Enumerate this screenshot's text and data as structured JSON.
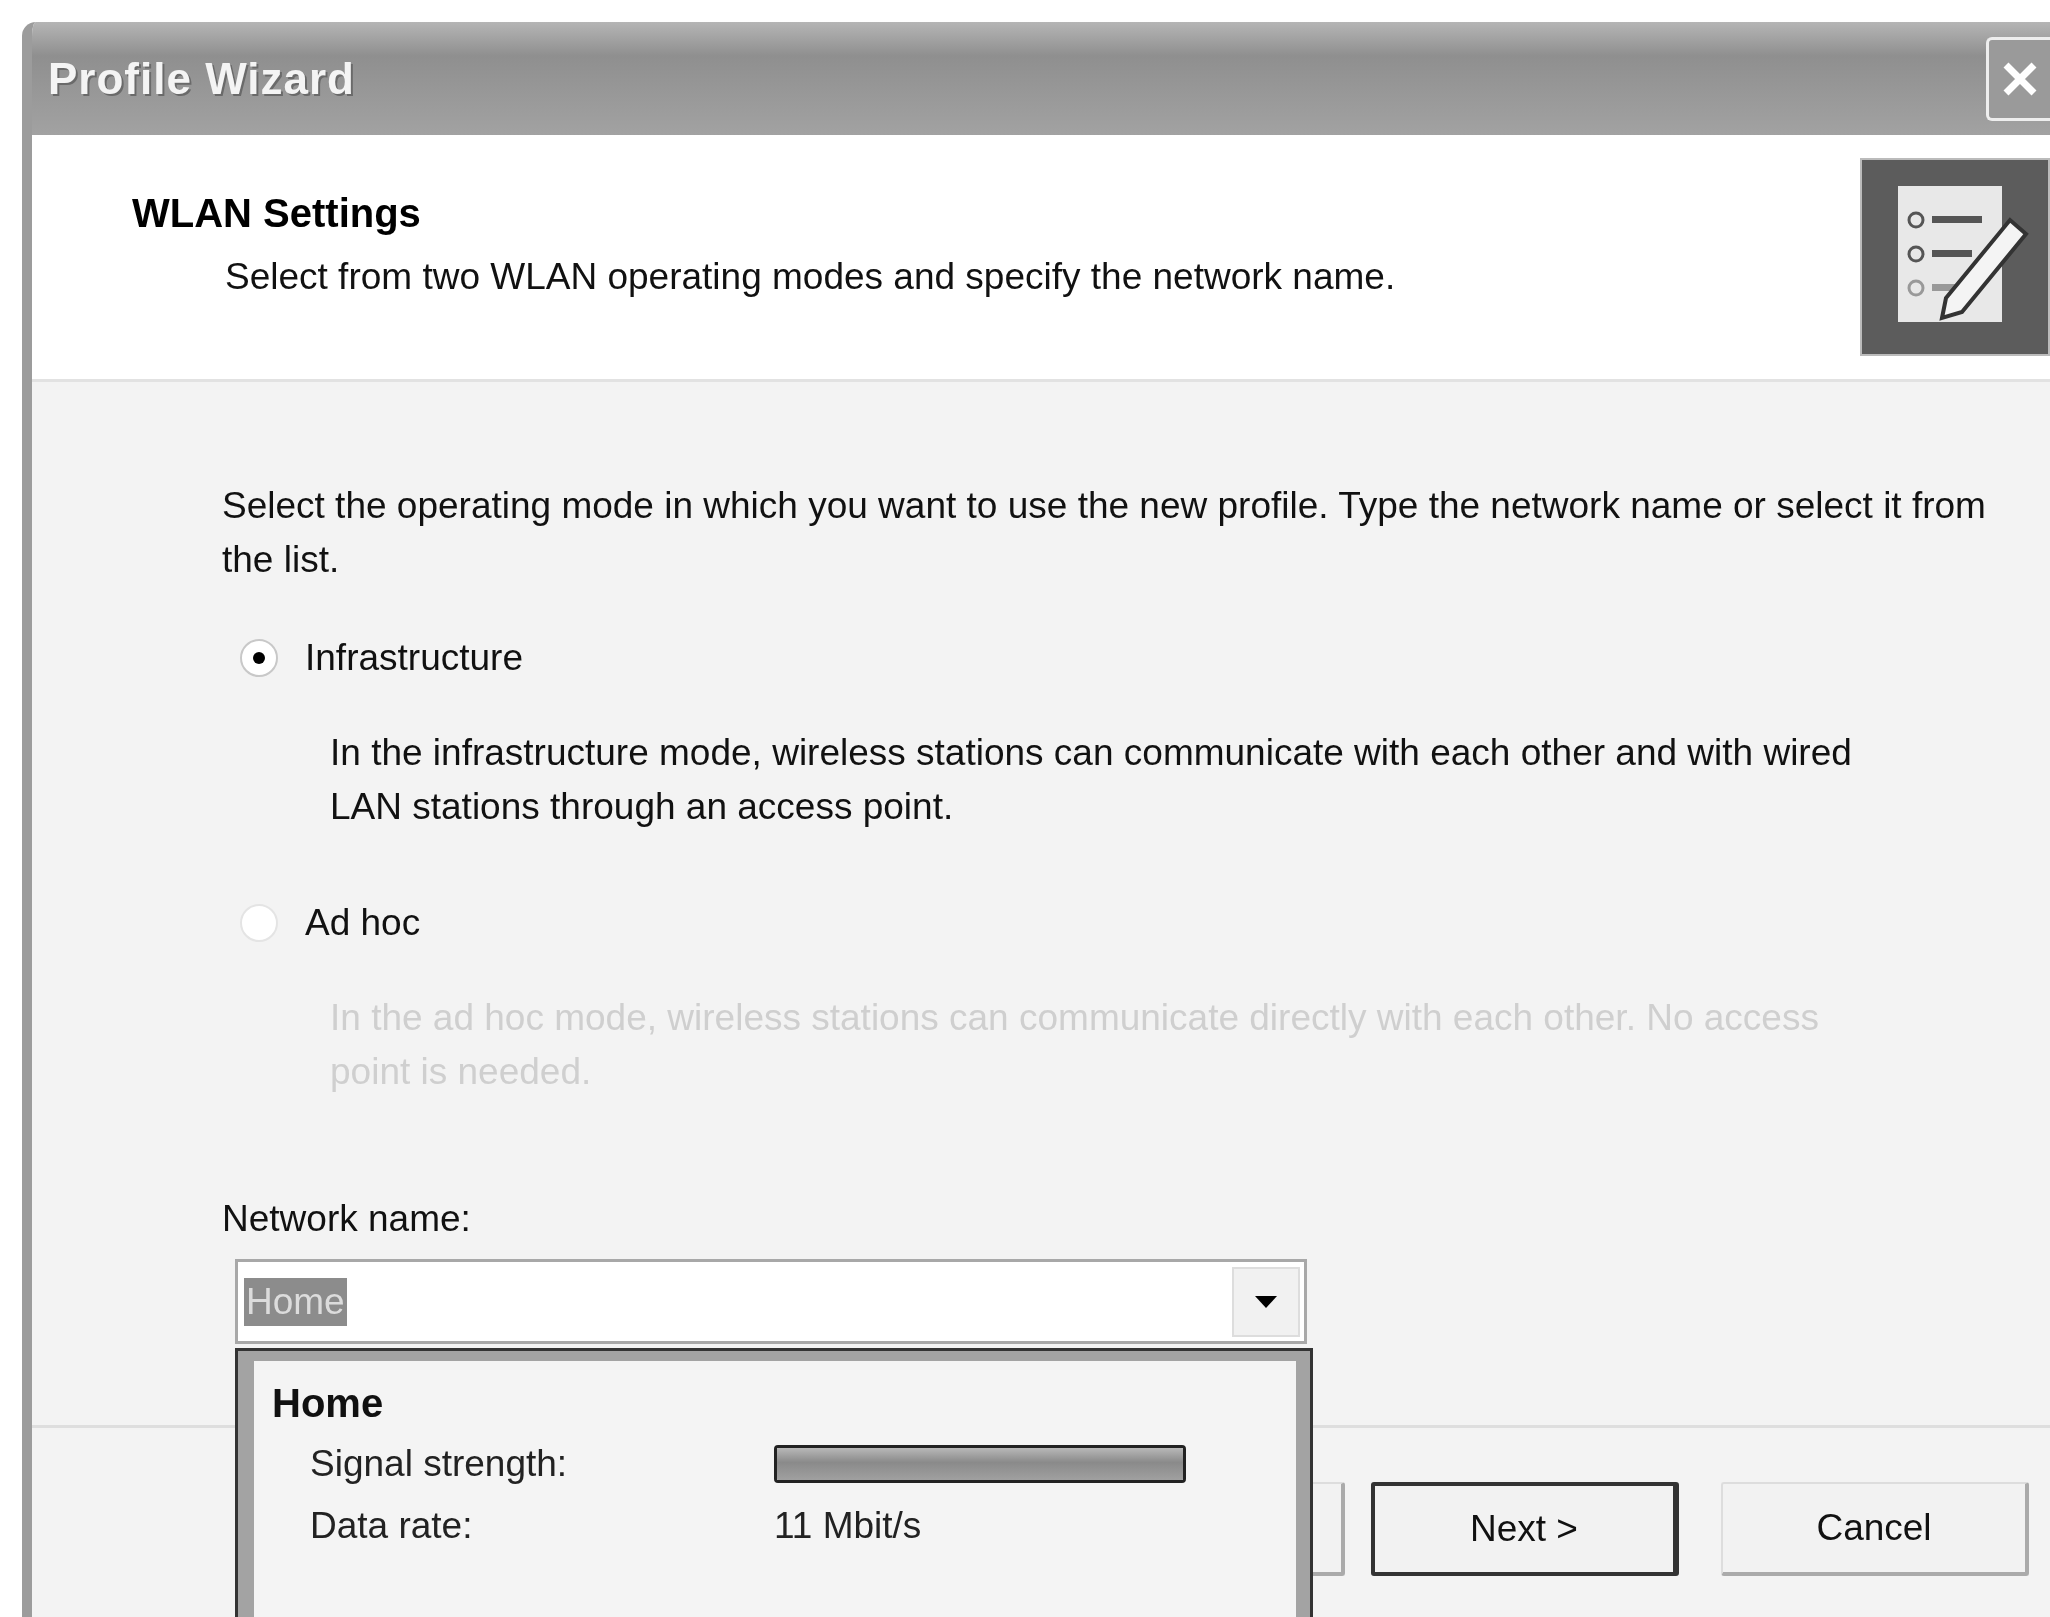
{
  "window": {
    "title": "Profile Wizard"
  },
  "header": {
    "title": "WLAN Settings",
    "subtitle": "Select from two WLAN operating modes and specify the network name."
  },
  "instructions": "Select the operating mode in which you want to use the new profile. Type the network name or select it from the list.",
  "modes": [
    {
      "label": "Infrastructure",
      "selected": true,
      "disabled": false,
      "description": "In the infrastructure mode, wireless stations can communicate with each other and with wired LAN stations through an access point."
    },
    {
      "label": "Ad hoc",
      "selected": false,
      "disabled": true,
      "description": "In the ad hoc mode, wireless stations can communicate directly with each other. No access point is needed."
    }
  ],
  "network_name": {
    "label": "Network name:",
    "value": "Home",
    "value_selected": true,
    "expanded": true,
    "items": [
      {
        "name": "Home",
        "fields": [
          {
            "kind": "meter",
            "label": "Signal strength:",
            "level": 1.0
          },
          {
            "kind": "text",
            "label": "Data rate:",
            "value": "11 Mbit/s"
          }
        ]
      }
    ]
  },
  "buttons": [
    {
      "kind": "covered"
    },
    {
      "kind": "button",
      "label": "Next >",
      "default": true
    },
    {
      "kind": "button",
      "label": "Cancel",
      "default": false
    }
  ]
}
